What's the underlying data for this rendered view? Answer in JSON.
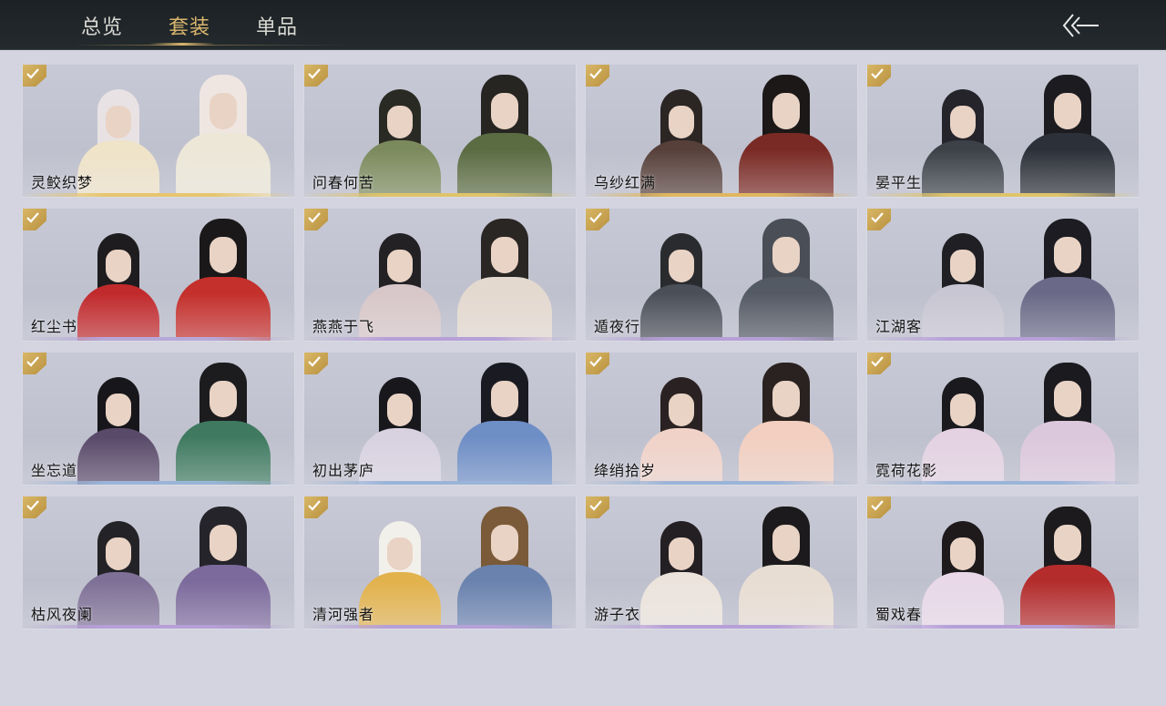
{
  "tabs": [
    {
      "label": "总览",
      "active": false
    },
    {
      "label": "套装",
      "active": true
    },
    {
      "label": "单品",
      "active": false
    }
  ],
  "back_icon": "back-arrow-icon",
  "check_icon": "checkmark-icon",
  "colors": {
    "accent": "#d9b66e",
    "topbar": "#1f2528",
    "background": "#d3d4e0"
  },
  "outfits": [
    {
      "name": "灵鲛织梦",
      "owned": true,
      "hairL": "#e9e2e4",
      "bodyL": "#efe3c8",
      "hairR": "#efe6e1",
      "bodyR": "#ece7d7",
      "glow": "#e6c56f"
    },
    {
      "name": "问春何苦",
      "owned": true,
      "hairL": "#2a2a25",
      "bodyL": "#7b8a5c",
      "hairR": "#262522",
      "bodyR": "#5b6c42",
      "glow": "#e0c46a"
    },
    {
      "name": "乌纱红满",
      "owned": true,
      "hairL": "#2b2624",
      "bodyL": "#57403a",
      "hairR": "#1c1818",
      "bodyR": "#7a2a24",
      "glow": "#e0b65f"
    },
    {
      "name": "晏平生",
      "owned": true,
      "hairL": "#24242a",
      "bodyL": "#3c4148",
      "hairR": "#1c1c20",
      "bodyR": "#2c3038",
      "glow": "#e0c46a"
    },
    {
      "name": "红尘书",
      "owned": true,
      "hairL": "#1e1c1e",
      "bodyL": "#c12a2c",
      "hairR": "#1a1819",
      "bodyR": "#c4302c",
      "glow": "#b6a8d8"
    },
    {
      "name": "燕燕于飞",
      "owned": true,
      "hairL": "#232124",
      "bodyL": "#d8c7c8",
      "hairR": "#2a2624",
      "bodyR": "#e4d9cf",
      "glow": "#b6a0d8"
    },
    {
      "name": "遁夜行",
      "owned": true,
      "hairL": "#2a2b2e",
      "bodyL": "#4b4f58",
      "hairR": "#4a4e56",
      "bodyR": "#545a64",
      "glow": "#b6a0d8"
    },
    {
      "name": "江湖客",
      "owned": true,
      "hairL": "#1f1f24",
      "bodyL": "#c8c6d2",
      "hairR": "#1c1c22",
      "bodyR": "#6a6a88",
      "glow": "#b6a0d8"
    },
    {
      "name": "坐忘道",
      "owned": true,
      "hairL": "#17161a",
      "bodyL": "#5a4a6a",
      "hairR": "#1c1c1e",
      "bodyR": "#3f7a60",
      "glow": "#9ab4d8"
    },
    {
      "name": "初出茅庐",
      "owned": true,
      "hairL": "#18171c",
      "bodyL": "#d8d2e0",
      "hairR": "#1a1b22",
      "bodyR": "#6e8ec6",
      "glow": "#9ab4d8"
    },
    {
      "name": "绛绡拾岁",
      "owned": true,
      "hairL": "#2a2222",
      "bodyL": "#f0d2c8",
      "hairR": "#2a2220",
      "bodyR": "#f2cfc0",
      "glow": "#9ab4d8"
    },
    {
      "name": "霓荷花影",
      "owned": true,
      "hairL": "#1a191e",
      "bodyL": "#e4d2e2",
      "hairR": "#1b1a1f",
      "bodyR": "#dcc8dc",
      "glow": "#9ab4d8"
    },
    {
      "name": "枯风夜阑",
      "owned": true,
      "hairL": "#232226",
      "bodyL": "#7e7096",
      "hairR": "#25242a",
      "bodyR": "#7c6a9c",
      "glow": "#b6a0d8"
    },
    {
      "name": "清河强者",
      "owned": true,
      "hairL": "#f2f0ea",
      "bodyL": "#e2b24c",
      "hairR": "#7a5a38",
      "bodyR": "#6a82ae",
      "glow": "#b6a0d8"
    },
    {
      "name": "游子衣",
      "owned": true,
      "hairL": "#231f22",
      "bodyL": "#ece4dc",
      "hairR": "#1c1a1c",
      "bodyR": "#e8ddd2",
      "glow": "#b6a0d8"
    },
    {
      "name": "蜀戏春",
      "owned": true,
      "hairL": "#1e1a1c",
      "bodyL": "#e8d8e8",
      "hairR": "#1c1a1c",
      "bodyR": "#b42c2c",
      "glow": "#b6a0d8"
    }
  ]
}
